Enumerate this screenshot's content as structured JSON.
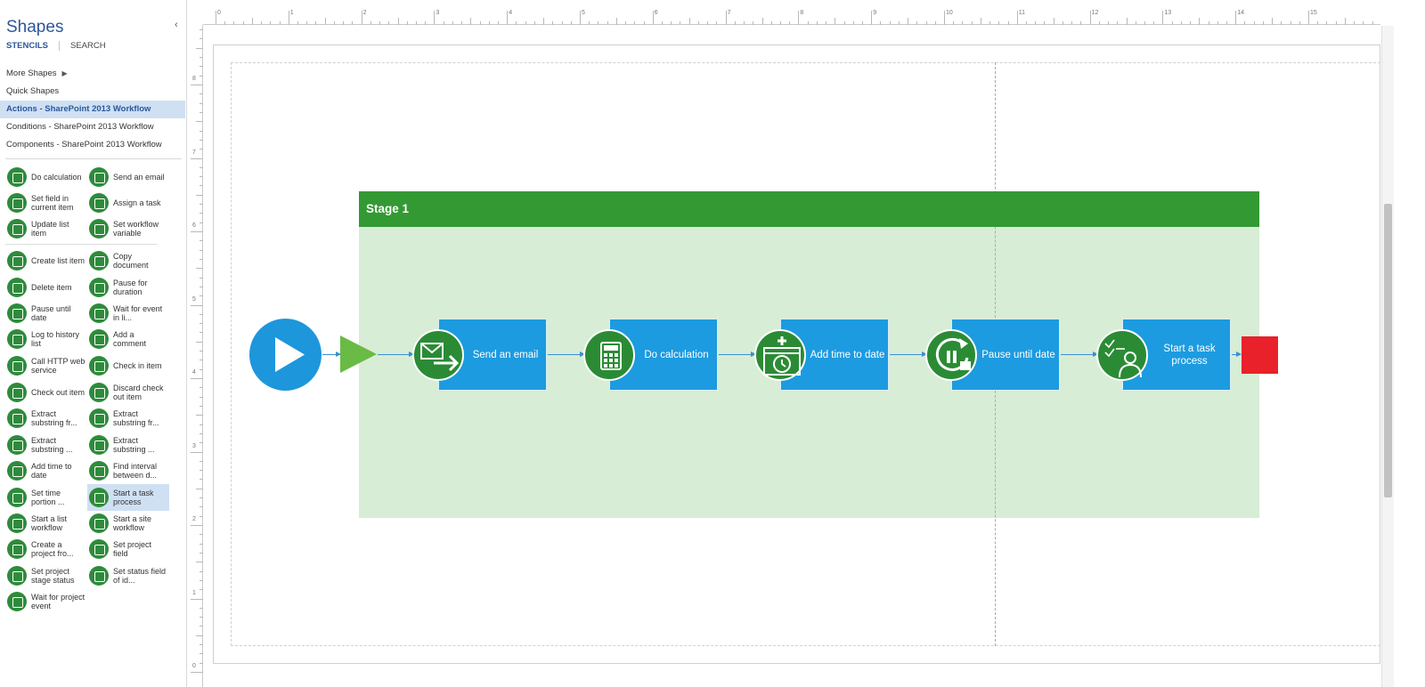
{
  "pane": {
    "title": "Shapes",
    "collapse_glyph": "‹",
    "tabs": [
      {
        "label": "STENCILS",
        "active": true
      },
      {
        "label": "SEARCH",
        "active": false
      }
    ],
    "stencils": [
      {
        "label": "More Shapes",
        "active": false,
        "has_arrow": true
      },
      {
        "label": "Quick Shapes",
        "active": false
      },
      {
        "label": "Actions - SharePoint 2013 Workflow",
        "active": true
      },
      {
        "label": "Conditions - SharePoint 2013 Workflow",
        "active": false
      },
      {
        "label": "Components - SharePoint 2013 Workflow",
        "active": false
      }
    ],
    "shapes": [
      {
        "label": "Do calculation",
        "icon": "calculator-icon"
      },
      {
        "label": "Send an email",
        "icon": "email-icon"
      },
      {
        "label": "Set field in current item",
        "icon": "list-field-icon"
      },
      {
        "label": "Assign a task",
        "icon": "assign-task-icon"
      },
      {
        "label": "Update list item",
        "icon": "list-update-icon"
      },
      {
        "label": "Set workflow variable",
        "icon": "variable-icon"
      },
      {
        "label": "Create list item",
        "icon": "list-create-icon"
      },
      {
        "label": "Copy document",
        "icon": "copy-document-icon"
      },
      {
        "label": "Delete item",
        "icon": "list-delete-icon"
      },
      {
        "label": "Pause for duration",
        "icon": "pause-duration-icon"
      },
      {
        "label": "Pause until date",
        "icon": "pause-date-icon"
      },
      {
        "label": "Wait for event in li...",
        "icon": "wait-event-icon"
      },
      {
        "label": "Log to history list",
        "icon": "log-history-icon"
      },
      {
        "label": "Add a comment",
        "icon": "comment-icon"
      },
      {
        "label": "Call HTTP web service",
        "icon": "globe-icon"
      },
      {
        "label": "Check in item",
        "icon": "check-in-icon"
      },
      {
        "label": "Check out item",
        "icon": "check-out-icon"
      },
      {
        "label": "Discard check out item",
        "icon": "discard-check-out-icon"
      },
      {
        "label": "Extract substring fr...",
        "icon": "extract-substring-icon"
      },
      {
        "label": "Extract substring fr...",
        "icon": "extract-substring-icon"
      },
      {
        "label": "Extract substring ...",
        "icon": "extract-substring-icon"
      },
      {
        "label": "Extract substring ...",
        "icon": "extract-substring-icon"
      },
      {
        "label": "Add time to date",
        "icon": "add-time-icon"
      },
      {
        "label": "Find interval between d...",
        "icon": "interval-icon"
      },
      {
        "label": "Set time portion ...",
        "icon": "time-portion-icon"
      },
      {
        "label": "Start a task process",
        "icon": "task-process-icon",
        "selected": true
      },
      {
        "label": "Start a list workflow",
        "icon": "list-workflow-icon"
      },
      {
        "label": "Start a site workflow",
        "icon": "site-workflow-icon"
      },
      {
        "label": "Create a project fro...",
        "icon": "project-create-icon"
      },
      {
        "label": "Set project field",
        "icon": "project-field-icon"
      },
      {
        "label": "Set project stage status",
        "icon": "project-stage-icon"
      },
      {
        "label": "Set status field of id...",
        "icon": "status-field-icon"
      },
      {
        "label": "Wait for project event",
        "icon": "project-event-icon"
      }
    ]
  },
  "rulers": {
    "top_labels": [
      "0",
      "1",
      "2",
      "3",
      "4",
      "5",
      "6",
      "7",
      "8",
      "9",
      "10",
      "11",
      "12",
      "13",
      "14",
      "15",
      "1"
    ],
    "left_labels": [
      "8",
      "7",
      "6",
      "5",
      "4",
      "3",
      "2",
      "1",
      "0"
    ]
  },
  "diagram": {
    "stage_title": "Stage   1",
    "actions": [
      {
        "label": "Send an email",
        "icon": "email-icon"
      },
      {
        "label": "Do calculation",
        "icon": "calculator-icon"
      },
      {
        "label": "Add time to date",
        "icon": "add-time-icon"
      },
      {
        "label": "Pause until date",
        "icon": "pause-date-icon"
      },
      {
        "label": "Start a task process",
        "icon": "task-process-icon"
      }
    ],
    "colors": {
      "stage_header": "#339933",
      "stage_body": "#d6ebd3",
      "action_box": "#1c9be0",
      "action_icon": "#2b8b35",
      "start": "#1d96dc",
      "entry": "#6abb45",
      "end": "#e8212b"
    }
  }
}
